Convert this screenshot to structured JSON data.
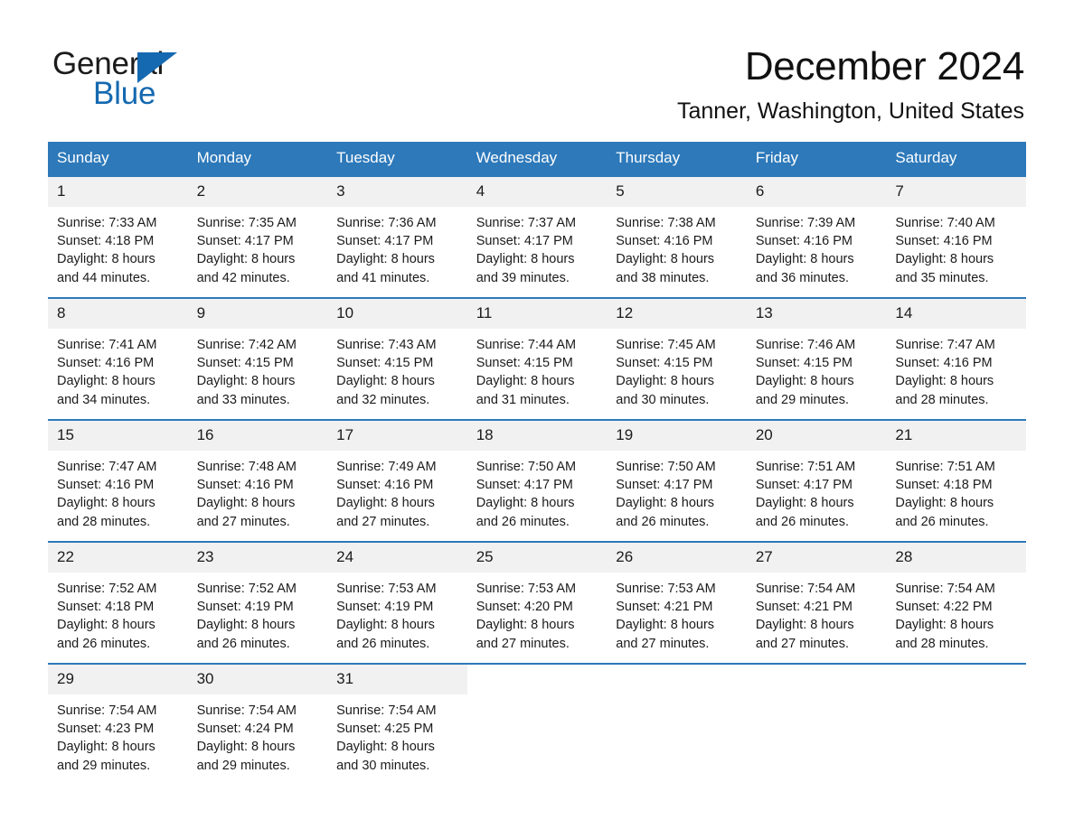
{
  "brand": {
    "name_part1": "General",
    "name_part2": "Blue",
    "accent_color": "#1569b0",
    "triangle_icon": "triangle-right-icon"
  },
  "header": {
    "month_title": "December 2024",
    "location": "Tanner, Washington, United States"
  },
  "calendar": {
    "header_bg": "#2d79ba",
    "daynum_bg": "#f1f1f1",
    "weekdays": [
      "Sunday",
      "Monday",
      "Tuesday",
      "Wednesday",
      "Thursday",
      "Friday",
      "Saturday"
    ],
    "weeks": [
      [
        {
          "day": "1",
          "sunrise": "Sunrise: 7:33 AM",
          "sunset": "Sunset: 4:18 PM",
          "daylight1": "Daylight: 8 hours",
          "daylight2": "and 44 minutes."
        },
        {
          "day": "2",
          "sunrise": "Sunrise: 7:35 AM",
          "sunset": "Sunset: 4:17 PM",
          "daylight1": "Daylight: 8 hours",
          "daylight2": "and 42 minutes."
        },
        {
          "day": "3",
          "sunrise": "Sunrise: 7:36 AM",
          "sunset": "Sunset: 4:17 PM",
          "daylight1": "Daylight: 8 hours",
          "daylight2": "and 41 minutes."
        },
        {
          "day": "4",
          "sunrise": "Sunrise: 7:37 AM",
          "sunset": "Sunset: 4:17 PM",
          "daylight1": "Daylight: 8 hours",
          "daylight2": "and 39 minutes."
        },
        {
          "day": "5",
          "sunrise": "Sunrise: 7:38 AM",
          "sunset": "Sunset: 4:16 PM",
          "daylight1": "Daylight: 8 hours",
          "daylight2": "and 38 minutes."
        },
        {
          "day": "6",
          "sunrise": "Sunrise: 7:39 AM",
          "sunset": "Sunset: 4:16 PM",
          "daylight1": "Daylight: 8 hours",
          "daylight2": "and 36 minutes."
        },
        {
          "day": "7",
          "sunrise": "Sunrise: 7:40 AM",
          "sunset": "Sunset: 4:16 PM",
          "daylight1": "Daylight: 8 hours",
          "daylight2": "and 35 minutes."
        }
      ],
      [
        {
          "day": "8",
          "sunrise": "Sunrise: 7:41 AM",
          "sunset": "Sunset: 4:16 PM",
          "daylight1": "Daylight: 8 hours",
          "daylight2": "and 34 minutes."
        },
        {
          "day": "9",
          "sunrise": "Sunrise: 7:42 AM",
          "sunset": "Sunset: 4:15 PM",
          "daylight1": "Daylight: 8 hours",
          "daylight2": "and 33 minutes."
        },
        {
          "day": "10",
          "sunrise": "Sunrise: 7:43 AM",
          "sunset": "Sunset: 4:15 PM",
          "daylight1": "Daylight: 8 hours",
          "daylight2": "and 32 minutes."
        },
        {
          "day": "11",
          "sunrise": "Sunrise: 7:44 AM",
          "sunset": "Sunset: 4:15 PM",
          "daylight1": "Daylight: 8 hours",
          "daylight2": "and 31 minutes."
        },
        {
          "day": "12",
          "sunrise": "Sunrise: 7:45 AM",
          "sunset": "Sunset: 4:15 PM",
          "daylight1": "Daylight: 8 hours",
          "daylight2": "and 30 minutes."
        },
        {
          "day": "13",
          "sunrise": "Sunrise: 7:46 AM",
          "sunset": "Sunset: 4:15 PM",
          "daylight1": "Daylight: 8 hours",
          "daylight2": "and 29 minutes."
        },
        {
          "day": "14",
          "sunrise": "Sunrise: 7:47 AM",
          "sunset": "Sunset: 4:16 PM",
          "daylight1": "Daylight: 8 hours",
          "daylight2": "and 28 minutes."
        }
      ],
      [
        {
          "day": "15",
          "sunrise": "Sunrise: 7:47 AM",
          "sunset": "Sunset: 4:16 PM",
          "daylight1": "Daylight: 8 hours",
          "daylight2": "and 28 minutes."
        },
        {
          "day": "16",
          "sunrise": "Sunrise: 7:48 AM",
          "sunset": "Sunset: 4:16 PM",
          "daylight1": "Daylight: 8 hours",
          "daylight2": "and 27 minutes."
        },
        {
          "day": "17",
          "sunrise": "Sunrise: 7:49 AM",
          "sunset": "Sunset: 4:16 PM",
          "daylight1": "Daylight: 8 hours",
          "daylight2": "and 27 minutes."
        },
        {
          "day": "18",
          "sunrise": "Sunrise: 7:50 AM",
          "sunset": "Sunset: 4:17 PM",
          "daylight1": "Daylight: 8 hours",
          "daylight2": "and 26 minutes."
        },
        {
          "day": "19",
          "sunrise": "Sunrise: 7:50 AM",
          "sunset": "Sunset: 4:17 PM",
          "daylight1": "Daylight: 8 hours",
          "daylight2": "and 26 minutes."
        },
        {
          "day": "20",
          "sunrise": "Sunrise: 7:51 AM",
          "sunset": "Sunset: 4:17 PM",
          "daylight1": "Daylight: 8 hours",
          "daylight2": "and 26 minutes."
        },
        {
          "day": "21",
          "sunrise": "Sunrise: 7:51 AM",
          "sunset": "Sunset: 4:18 PM",
          "daylight1": "Daylight: 8 hours",
          "daylight2": "and 26 minutes."
        }
      ],
      [
        {
          "day": "22",
          "sunrise": "Sunrise: 7:52 AM",
          "sunset": "Sunset: 4:18 PM",
          "daylight1": "Daylight: 8 hours",
          "daylight2": "and 26 minutes."
        },
        {
          "day": "23",
          "sunrise": "Sunrise: 7:52 AM",
          "sunset": "Sunset: 4:19 PM",
          "daylight1": "Daylight: 8 hours",
          "daylight2": "and 26 minutes."
        },
        {
          "day": "24",
          "sunrise": "Sunrise: 7:53 AM",
          "sunset": "Sunset: 4:19 PM",
          "daylight1": "Daylight: 8 hours",
          "daylight2": "and 26 minutes."
        },
        {
          "day": "25",
          "sunrise": "Sunrise: 7:53 AM",
          "sunset": "Sunset: 4:20 PM",
          "daylight1": "Daylight: 8 hours",
          "daylight2": "and 27 minutes."
        },
        {
          "day": "26",
          "sunrise": "Sunrise: 7:53 AM",
          "sunset": "Sunset: 4:21 PM",
          "daylight1": "Daylight: 8 hours",
          "daylight2": "and 27 minutes."
        },
        {
          "day": "27",
          "sunrise": "Sunrise: 7:54 AM",
          "sunset": "Sunset: 4:21 PM",
          "daylight1": "Daylight: 8 hours",
          "daylight2": "and 27 minutes."
        },
        {
          "day": "28",
          "sunrise": "Sunrise: 7:54 AM",
          "sunset": "Sunset: 4:22 PM",
          "daylight1": "Daylight: 8 hours",
          "daylight2": "and 28 minutes."
        }
      ],
      [
        {
          "day": "29",
          "sunrise": "Sunrise: 7:54 AM",
          "sunset": "Sunset: 4:23 PM",
          "daylight1": "Daylight: 8 hours",
          "daylight2": "and 29 minutes."
        },
        {
          "day": "30",
          "sunrise": "Sunrise: 7:54 AM",
          "sunset": "Sunset: 4:24 PM",
          "daylight1": "Daylight: 8 hours",
          "daylight2": "and 29 minutes."
        },
        {
          "day": "31",
          "sunrise": "Sunrise: 7:54 AM",
          "sunset": "Sunset: 4:25 PM",
          "daylight1": "Daylight: 8 hours",
          "daylight2": "and 30 minutes."
        },
        {
          "day": "",
          "sunrise": "",
          "sunset": "",
          "daylight1": "",
          "daylight2": ""
        },
        {
          "day": "",
          "sunrise": "",
          "sunset": "",
          "daylight1": "",
          "daylight2": ""
        },
        {
          "day": "",
          "sunrise": "",
          "sunset": "",
          "daylight1": "",
          "daylight2": ""
        },
        {
          "day": "",
          "sunrise": "",
          "sunset": "",
          "daylight1": "",
          "daylight2": ""
        }
      ]
    ]
  }
}
